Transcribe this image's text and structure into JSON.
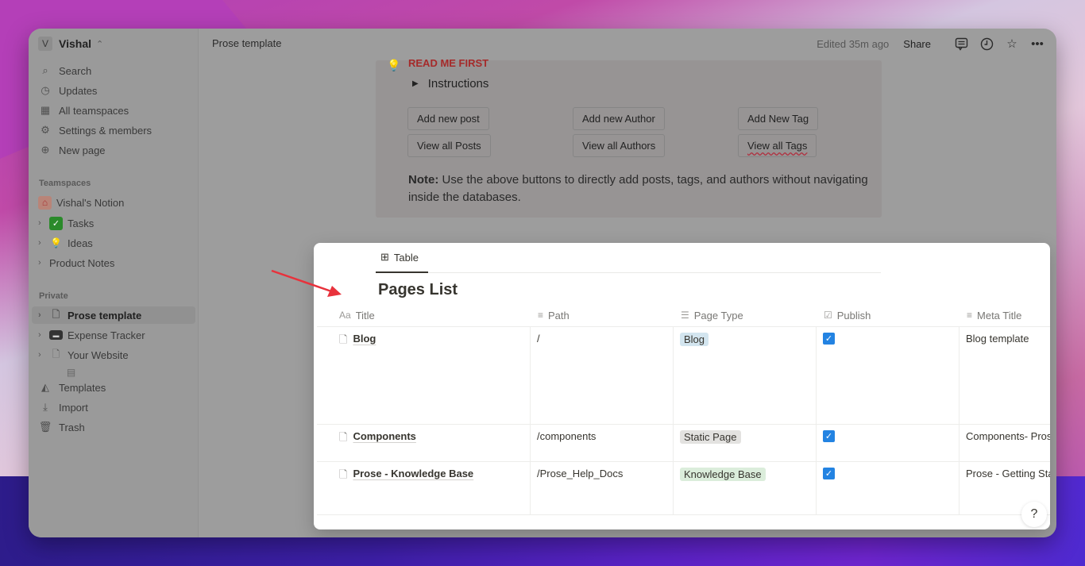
{
  "workspace": {
    "initial": "V",
    "name": "Vishal",
    "switch_icon": "chevron-updown-icon"
  },
  "sidebar": {
    "top_items": [
      {
        "label": "Search",
        "icon": "search-icon"
      },
      {
        "label": "Updates",
        "icon": "clock-icon"
      },
      {
        "label": "All teamspaces",
        "icon": "building-icon"
      },
      {
        "label": "Settings & members",
        "icon": "gear-icon"
      },
      {
        "label": "New page",
        "icon": "plus-circle-icon"
      }
    ],
    "teamspaces_label": "Teamspaces",
    "teamspaces": [
      {
        "label": "Vishal's Notion",
        "icon": "home-icon"
      },
      {
        "label": "Tasks",
        "icon": "checkmark-icon"
      },
      {
        "label": "Ideas",
        "icon": "lightbulb-icon"
      },
      {
        "label": "Product Notes",
        "icon": "notepad-icon"
      }
    ],
    "private_label": "Private",
    "private": [
      {
        "label": "Prose template",
        "icon": "document-icon",
        "active": true
      },
      {
        "label": "Expense Tracker",
        "icon": "card-icon"
      },
      {
        "label": "Your Website",
        "icon": "document-icon"
      }
    ],
    "bottom_items": [
      {
        "label": "Templates",
        "icon": "templates-icon"
      },
      {
        "label": "Import",
        "icon": "download-icon"
      },
      {
        "label": "Trash",
        "icon": "trash-icon"
      }
    ]
  },
  "topbar": {
    "breadcrumb": "Prose template",
    "edited": "Edited 35m ago",
    "share_label": "Share"
  },
  "callout": {
    "title": "READ ME FIRST",
    "toggle_label": "Instructions",
    "buttons": [
      [
        "Add new post",
        "Add new Author",
        "Add New Tag"
      ],
      [
        "View all Posts",
        "View all Authors",
        "View all Tags"
      ]
    ],
    "note_bold": "Note:",
    "note_text": " Use the above buttons to directly add posts, tags, and authors without navigating inside the databases."
  },
  "database": {
    "view_tab": "Table",
    "title": "Pages List",
    "columns": [
      {
        "label": "Title",
        "icon": "Aa"
      },
      {
        "label": "Path",
        "icon": "text-icon"
      },
      {
        "label": "Page Type",
        "icon": "list-icon"
      },
      {
        "label": "Publish",
        "icon": "checkbox-icon"
      },
      {
        "label": "Meta Title",
        "icon": "text-icon"
      }
    ],
    "rows": [
      {
        "title": "Blog",
        "path": "/",
        "page_type": "Blog",
        "tag_color": "#d3e5ef",
        "publish": true,
        "meta_title": "Blog template"
      },
      {
        "title": "Components",
        "path": "/components",
        "page_type": "Static Page",
        "tag_color": "#e3e2e0",
        "publish": true,
        "meta_title": "Components- Prose"
      },
      {
        "title": "Prose - Knowledge Base",
        "path": "/Prose_Help_Docs",
        "page_type": "Knowledge Base",
        "tag_color": "#dbeddb",
        "publish": true,
        "meta_title": "Prose - Getting Star"
      }
    ],
    "help_label": "?"
  },
  "annotation": {
    "arrow_color": "#e8323c"
  }
}
